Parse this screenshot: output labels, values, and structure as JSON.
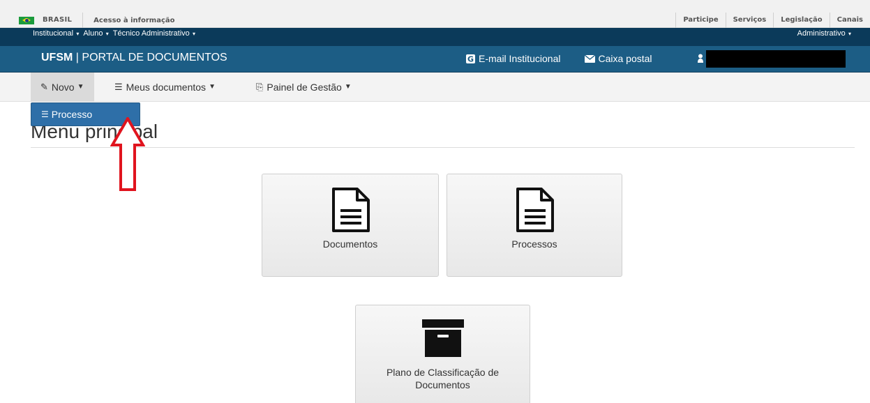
{
  "gov_bar": {
    "brasil": "BRASIL",
    "acesso": "Acesso à informação",
    "links": [
      "Participe",
      "Serviços",
      "Legislação",
      "Canais"
    ]
  },
  "inst_bar": {
    "left": [
      "Institucional",
      "Aluno",
      "Técnico Administrativo"
    ],
    "right": "Administrativo"
  },
  "portal": {
    "brand": "UFSM",
    "separator": "|",
    "title": "PORTAL DE DOCUMENTOS",
    "email": "E-mail Institucional",
    "mailbox": "Caixa postal"
  },
  "nav": {
    "novo": "Novo",
    "meus_documentos": "Meus documentos",
    "painel": "Painel de Gestão"
  },
  "dropdown": {
    "processo": "Processo"
  },
  "page": {
    "title": "Menu principal"
  },
  "tiles": {
    "documentos": "Documentos",
    "processos": "Processos",
    "plano_line1": "Plano de Classificação de",
    "plano_line2": "Documentos"
  },
  "colors": {
    "header_blue": "#1c5d85",
    "dark_blue": "#0b3a5a",
    "dropdown_blue": "#2e6fa8",
    "arrow_red": "#e0141e"
  },
  "icons": {
    "flag": "brazil-flag-icon",
    "email": "google-icon",
    "mailbox": "envelope-icon",
    "user": "user-icon",
    "novo": "pencil-icon",
    "meus_documentos": "list-icon",
    "painel": "files-icon",
    "processo": "list-icon",
    "documentos": "file-text-icon",
    "processos": "file-text-icon",
    "plano": "archive-box-icon",
    "annotation": "red-up-arrow-icon"
  }
}
